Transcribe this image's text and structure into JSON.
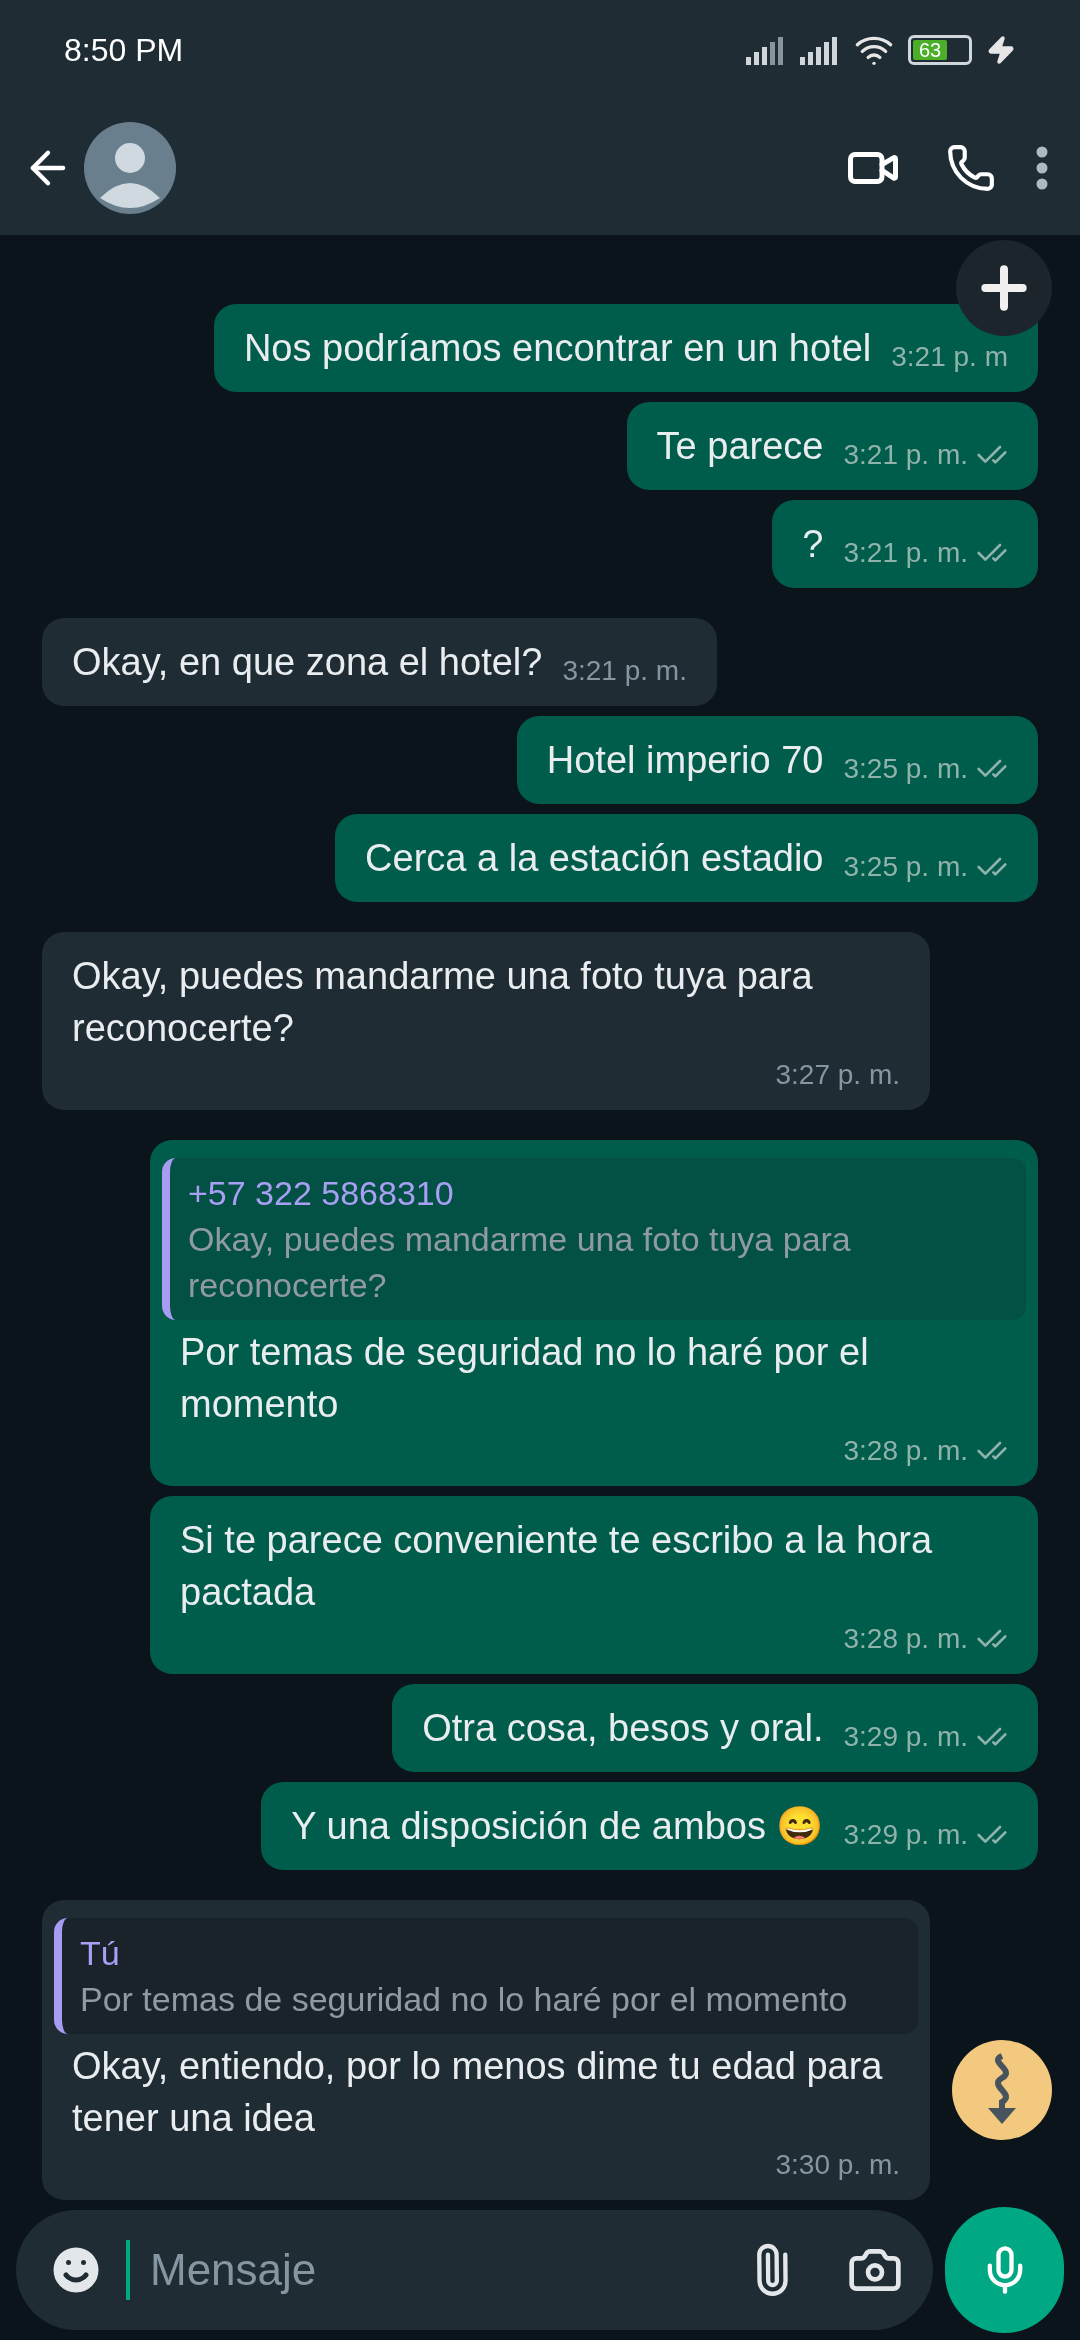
{
  "status_bar": {
    "time": "8:50 PM",
    "battery": "63",
    "charging": true
  },
  "messages": [
    {
      "kind": "out",
      "text": "Nos podríamos encontrar en un hotel",
      "time": "3:21 p. m",
      "ticks": false
    },
    {
      "kind": "out",
      "text": "Te parece",
      "time": "3:21 p. m.",
      "ticks": true
    },
    {
      "kind": "out",
      "text": "?",
      "time": "3:21 p. m.",
      "ticks": true
    },
    {
      "kind": "in",
      "text": "Okay, en que zona el hotel?",
      "time": "3:21 p. m."
    },
    {
      "kind": "out",
      "text": "Hotel imperio 70",
      "time": "3:25 p. m.",
      "ticks": true
    },
    {
      "kind": "out",
      "text": "Cerca a la estación estadio",
      "time": "3:25 p. m.",
      "ticks": true
    },
    {
      "kind": "in",
      "text": "Okay, puedes mandarme una foto tuya para reconocerte?",
      "time": "3:27 p. m."
    },
    {
      "kind": "out",
      "quote": {
        "author": "+57 322 5868310",
        "text": "Okay, puedes mandarme una foto tuya para reconocerte?"
      },
      "text": "Por temas de seguridad no lo haré por el momento",
      "time": "3:28 p. m.",
      "ticks": true
    },
    {
      "kind": "out",
      "text": "Si te parece conveniente te escribo a la hora pactada",
      "time": "3:28 p. m.",
      "ticks": true
    },
    {
      "kind": "out",
      "text": "Otra cosa, besos y oral.",
      "time": "3:29 p. m.",
      "ticks": true
    },
    {
      "kind": "out",
      "text": "Y una disposición de ambos 😄",
      "time": "3:29 p. m.",
      "ticks": true
    },
    {
      "kind": "in",
      "quote": {
        "author": "Tú",
        "text": "Por temas de seguridad no lo haré por el momento"
      },
      "text": "Okay, entiendo, por lo menos dime tu edad para tener una idea",
      "time": "3:30 p. m."
    }
  ],
  "composer": {
    "placeholder": "Mensaje"
  }
}
